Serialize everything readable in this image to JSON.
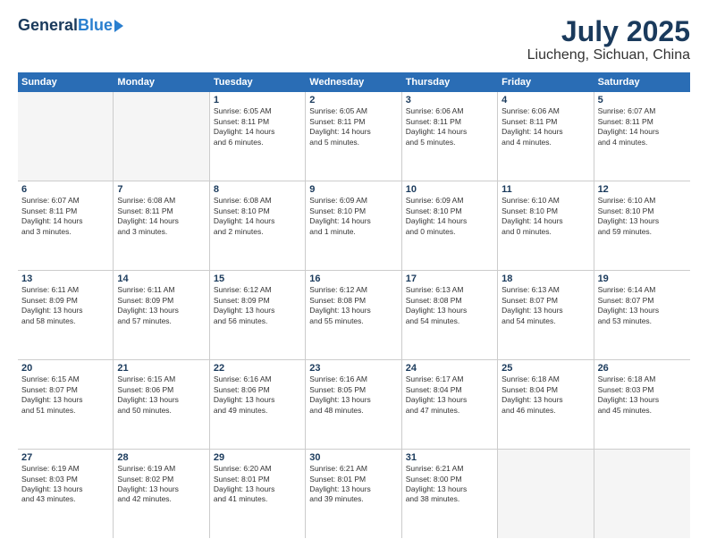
{
  "header": {
    "logo_general": "General",
    "logo_blue": "Blue",
    "title": "July 2025",
    "subtitle": "Liucheng, Sichuan, China"
  },
  "weekdays": [
    "Sunday",
    "Monday",
    "Tuesday",
    "Wednesday",
    "Thursday",
    "Friday",
    "Saturday"
  ],
  "rows": [
    [
      {
        "day": "",
        "lines": []
      },
      {
        "day": "",
        "lines": []
      },
      {
        "day": "1",
        "lines": [
          "Sunrise: 6:05 AM",
          "Sunset: 8:11 PM",
          "Daylight: 14 hours",
          "and 6 minutes."
        ]
      },
      {
        "day": "2",
        "lines": [
          "Sunrise: 6:05 AM",
          "Sunset: 8:11 PM",
          "Daylight: 14 hours",
          "and 5 minutes."
        ]
      },
      {
        "day": "3",
        "lines": [
          "Sunrise: 6:06 AM",
          "Sunset: 8:11 PM",
          "Daylight: 14 hours",
          "and 5 minutes."
        ]
      },
      {
        "day": "4",
        "lines": [
          "Sunrise: 6:06 AM",
          "Sunset: 8:11 PM",
          "Daylight: 14 hours",
          "and 4 minutes."
        ]
      },
      {
        "day": "5",
        "lines": [
          "Sunrise: 6:07 AM",
          "Sunset: 8:11 PM",
          "Daylight: 14 hours",
          "and 4 minutes."
        ]
      }
    ],
    [
      {
        "day": "6",
        "lines": [
          "Sunrise: 6:07 AM",
          "Sunset: 8:11 PM",
          "Daylight: 14 hours",
          "and 3 minutes."
        ]
      },
      {
        "day": "7",
        "lines": [
          "Sunrise: 6:08 AM",
          "Sunset: 8:11 PM",
          "Daylight: 14 hours",
          "and 3 minutes."
        ]
      },
      {
        "day": "8",
        "lines": [
          "Sunrise: 6:08 AM",
          "Sunset: 8:10 PM",
          "Daylight: 14 hours",
          "and 2 minutes."
        ]
      },
      {
        "day": "9",
        "lines": [
          "Sunrise: 6:09 AM",
          "Sunset: 8:10 PM",
          "Daylight: 14 hours",
          "and 1 minute."
        ]
      },
      {
        "day": "10",
        "lines": [
          "Sunrise: 6:09 AM",
          "Sunset: 8:10 PM",
          "Daylight: 14 hours",
          "and 0 minutes."
        ]
      },
      {
        "day": "11",
        "lines": [
          "Sunrise: 6:10 AM",
          "Sunset: 8:10 PM",
          "Daylight: 14 hours",
          "and 0 minutes."
        ]
      },
      {
        "day": "12",
        "lines": [
          "Sunrise: 6:10 AM",
          "Sunset: 8:10 PM",
          "Daylight: 13 hours",
          "and 59 minutes."
        ]
      }
    ],
    [
      {
        "day": "13",
        "lines": [
          "Sunrise: 6:11 AM",
          "Sunset: 8:09 PM",
          "Daylight: 13 hours",
          "and 58 minutes."
        ]
      },
      {
        "day": "14",
        "lines": [
          "Sunrise: 6:11 AM",
          "Sunset: 8:09 PM",
          "Daylight: 13 hours",
          "and 57 minutes."
        ]
      },
      {
        "day": "15",
        "lines": [
          "Sunrise: 6:12 AM",
          "Sunset: 8:09 PM",
          "Daylight: 13 hours",
          "and 56 minutes."
        ]
      },
      {
        "day": "16",
        "lines": [
          "Sunrise: 6:12 AM",
          "Sunset: 8:08 PM",
          "Daylight: 13 hours",
          "and 55 minutes."
        ]
      },
      {
        "day": "17",
        "lines": [
          "Sunrise: 6:13 AM",
          "Sunset: 8:08 PM",
          "Daylight: 13 hours",
          "and 54 minutes."
        ]
      },
      {
        "day": "18",
        "lines": [
          "Sunrise: 6:13 AM",
          "Sunset: 8:07 PM",
          "Daylight: 13 hours",
          "and 54 minutes."
        ]
      },
      {
        "day": "19",
        "lines": [
          "Sunrise: 6:14 AM",
          "Sunset: 8:07 PM",
          "Daylight: 13 hours",
          "and 53 minutes."
        ]
      }
    ],
    [
      {
        "day": "20",
        "lines": [
          "Sunrise: 6:15 AM",
          "Sunset: 8:07 PM",
          "Daylight: 13 hours",
          "and 51 minutes."
        ]
      },
      {
        "day": "21",
        "lines": [
          "Sunrise: 6:15 AM",
          "Sunset: 8:06 PM",
          "Daylight: 13 hours",
          "and 50 minutes."
        ]
      },
      {
        "day": "22",
        "lines": [
          "Sunrise: 6:16 AM",
          "Sunset: 8:06 PM",
          "Daylight: 13 hours",
          "and 49 minutes."
        ]
      },
      {
        "day": "23",
        "lines": [
          "Sunrise: 6:16 AM",
          "Sunset: 8:05 PM",
          "Daylight: 13 hours",
          "and 48 minutes."
        ]
      },
      {
        "day": "24",
        "lines": [
          "Sunrise: 6:17 AM",
          "Sunset: 8:04 PM",
          "Daylight: 13 hours",
          "and 47 minutes."
        ]
      },
      {
        "day": "25",
        "lines": [
          "Sunrise: 6:18 AM",
          "Sunset: 8:04 PM",
          "Daylight: 13 hours",
          "and 46 minutes."
        ]
      },
      {
        "day": "26",
        "lines": [
          "Sunrise: 6:18 AM",
          "Sunset: 8:03 PM",
          "Daylight: 13 hours",
          "and 45 minutes."
        ]
      }
    ],
    [
      {
        "day": "27",
        "lines": [
          "Sunrise: 6:19 AM",
          "Sunset: 8:03 PM",
          "Daylight: 13 hours",
          "and 43 minutes."
        ]
      },
      {
        "day": "28",
        "lines": [
          "Sunrise: 6:19 AM",
          "Sunset: 8:02 PM",
          "Daylight: 13 hours",
          "and 42 minutes."
        ]
      },
      {
        "day": "29",
        "lines": [
          "Sunrise: 6:20 AM",
          "Sunset: 8:01 PM",
          "Daylight: 13 hours",
          "and 41 minutes."
        ]
      },
      {
        "day": "30",
        "lines": [
          "Sunrise: 6:21 AM",
          "Sunset: 8:01 PM",
          "Daylight: 13 hours",
          "and 39 minutes."
        ]
      },
      {
        "day": "31",
        "lines": [
          "Sunrise: 6:21 AM",
          "Sunset: 8:00 PM",
          "Daylight: 13 hours",
          "and 38 minutes."
        ]
      },
      {
        "day": "",
        "lines": []
      },
      {
        "day": "",
        "lines": []
      }
    ]
  ]
}
